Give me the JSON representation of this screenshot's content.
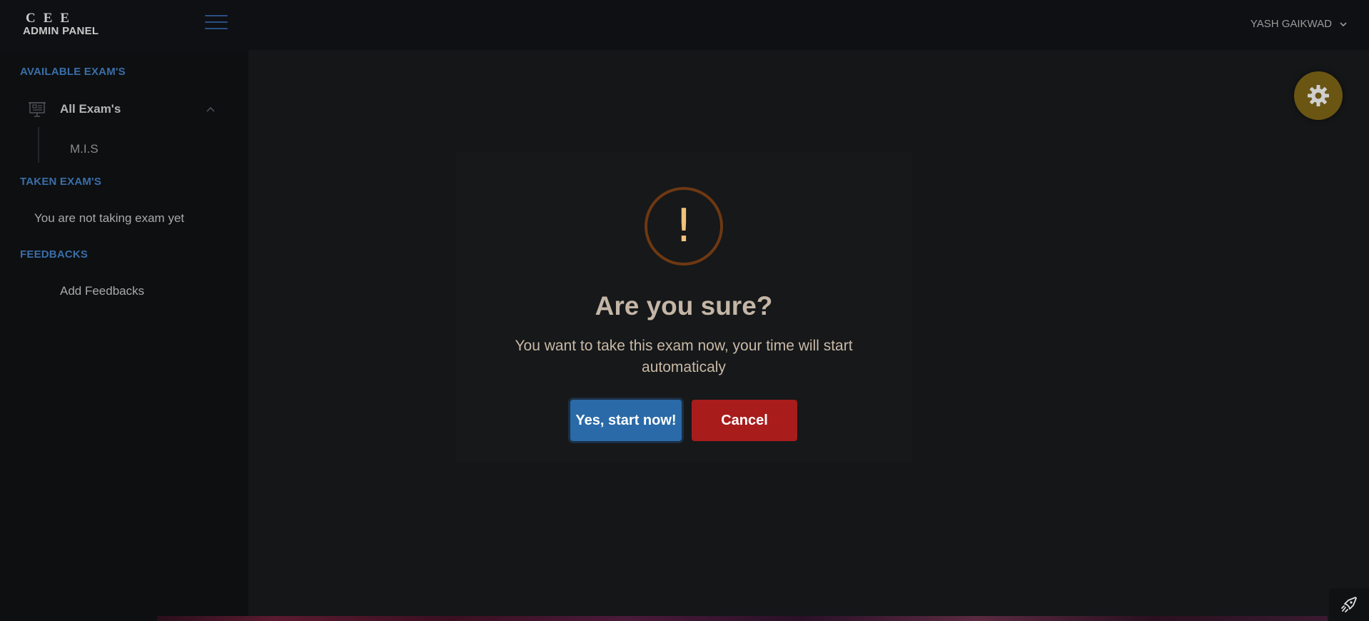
{
  "header": {
    "logo_brand": "CEE",
    "logo_sub": "ADMIN PANEL",
    "user_name": "YASH GAIKWAD"
  },
  "sidebar": {
    "sections": {
      "available": "AVAILABLE EXAM'S",
      "taken": "TAKEN EXAM'S",
      "feedbacks": "FEEDBACKS"
    },
    "all_exams_label": "All Exam's",
    "exam_items": [
      "M.I.S"
    ],
    "taken_empty_text": "You are not taking exam yet",
    "add_feedback_label": "Add Feedbacks"
  },
  "modal": {
    "icon_glyph": "!",
    "title": "Are you sure?",
    "text": "You want to take this exam now, your time will start automaticaly",
    "confirm_label": "Yes, start now!",
    "cancel_label": "Cancel"
  },
  "colors": {
    "section_title": "#3a6ea8",
    "confirm_button": "#2a6aa8",
    "cancel_button": "#a81c1c",
    "warning_ring": "#6e3812",
    "gear_fab": "#6b5513"
  },
  "icons": {
    "menu": "hamburger-icon",
    "user_dropdown": "chevron-down-icon",
    "exam_group": "presentation-board-icon",
    "collapse": "chevron-up-icon",
    "settings": "gear-icon",
    "warning": "exclamation-icon",
    "corner": "rocket-icon"
  }
}
